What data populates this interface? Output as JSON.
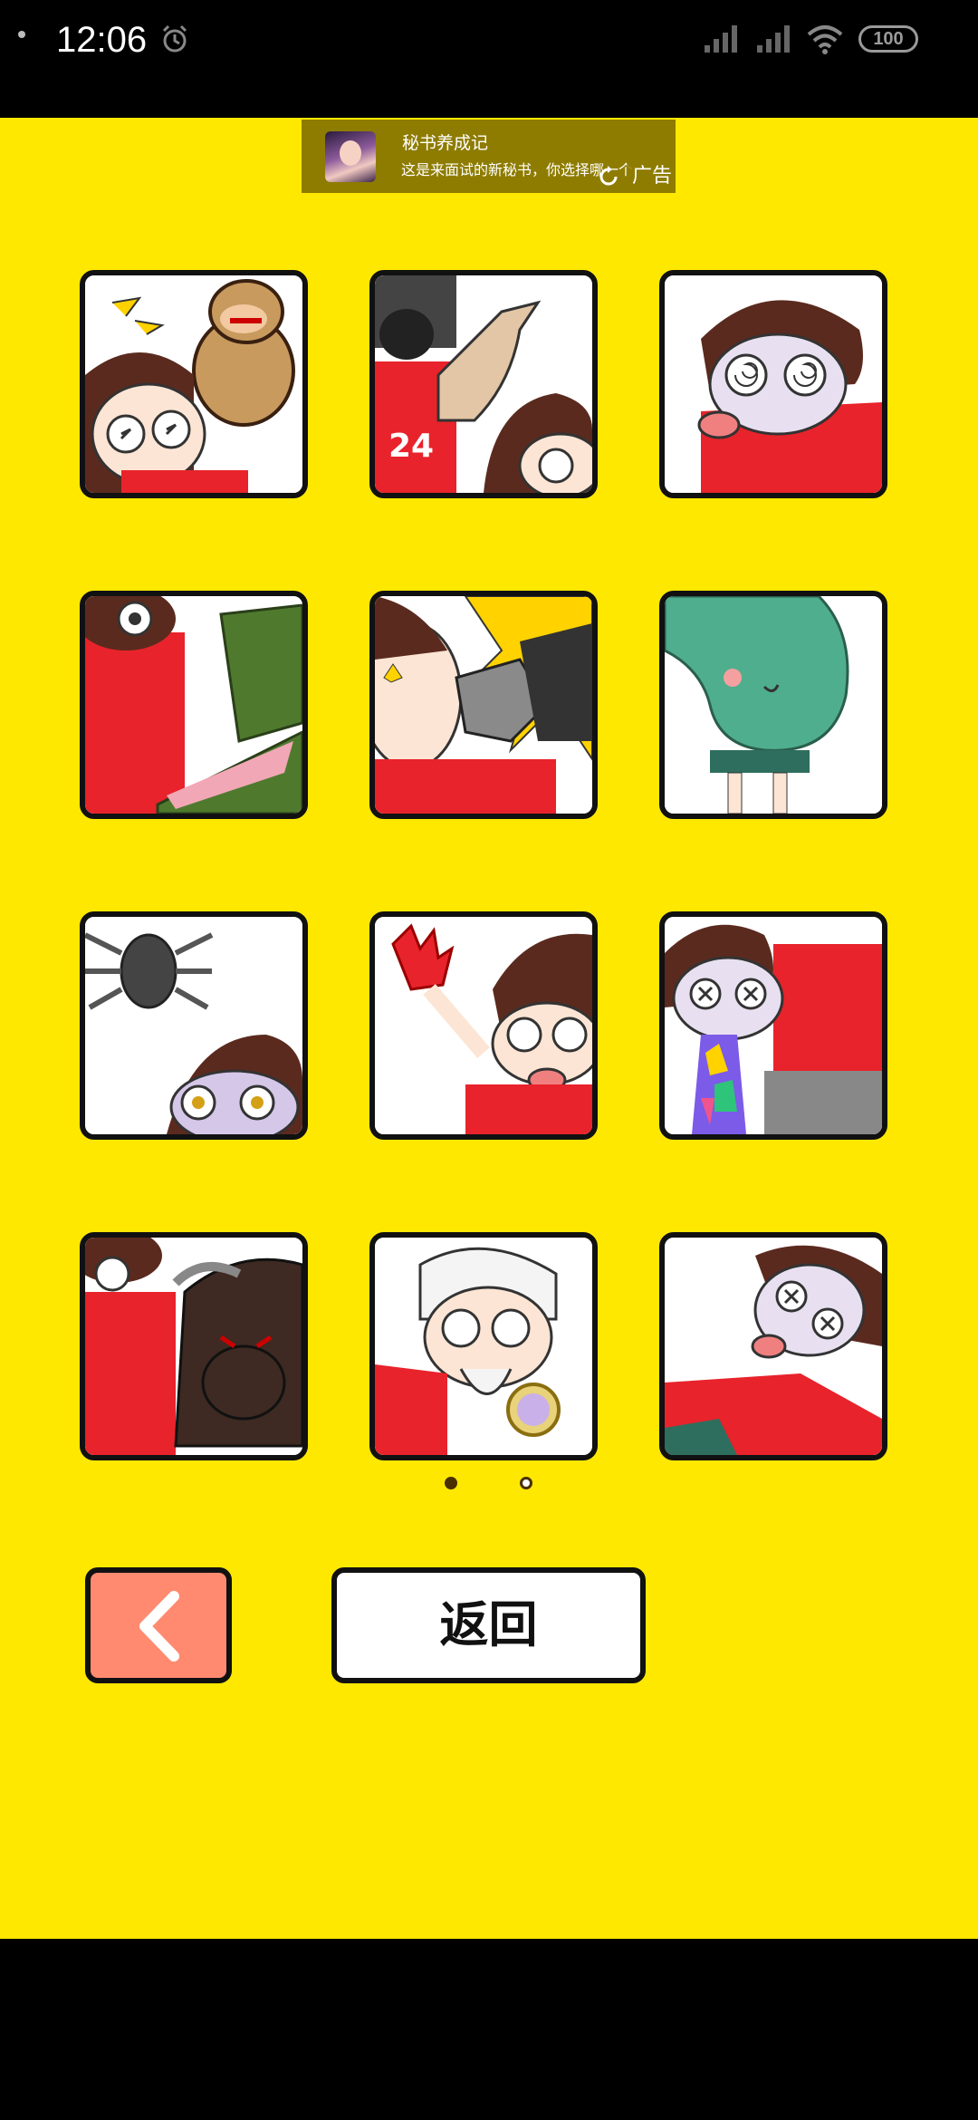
{
  "status_bar": {
    "time": "12:06",
    "battery": "100",
    "icons": [
      "alarm-icon",
      "signal-icon",
      "signal-hd-icon",
      "wifi-icon",
      "battery-icon"
    ]
  },
  "ad": {
    "title": "秘书养成记",
    "description": "这是来面试的新秘书，你选择哪一个",
    "mark": "广告"
  },
  "stickers": [
    {
      "name": "monkey-attack"
    },
    {
      "name": "muscle-arm"
    },
    {
      "name": "dizzy-face"
    },
    {
      "name": "crocodile"
    },
    {
      "name": "punch"
    },
    {
      "name": "green-blob"
    },
    {
      "name": "spider"
    },
    {
      "name": "red-hand"
    },
    {
      "name": "rainbow-vomit"
    },
    {
      "name": "buffalo"
    },
    {
      "name": "old-man-compass"
    },
    {
      "name": "knocked-out"
    }
  ],
  "pagination": {
    "current": 1,
    "total": 2
  },
  "buttons": {
    "prev_icon": "chevron-left-icon",
    "back_label": "返回"
  },
  "colors": {
    "background": "#FFE800",
    "prev_button": "#FF8A70",
    "ad_background": "#8E7C00",
    "character_shirt": "#E8232B",
    "character_hair": "#5B2A1E"
  }
}
